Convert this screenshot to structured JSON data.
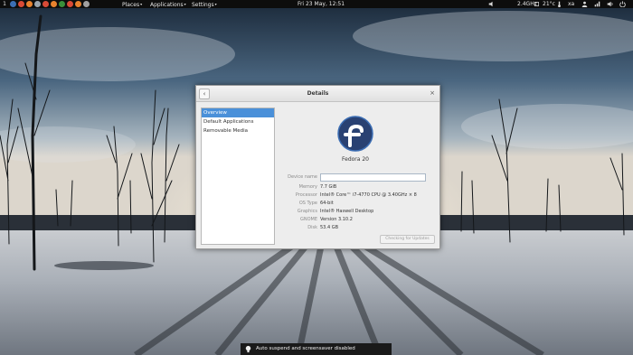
{
  "panel": {
    "workspace": "1",
    "launchers": [
      {
        "icon": "terminal-icon",
        "color": "#3c6fb4"
      },
      {
        "icon": "chrome-icon",
        "color": "#d94a36"
      },
      {
        "icon": "firefox-icon",
        "color": "#e8822e"
      },
      {
        "icon": "files-icon",
        "color": "#9aa4ad"
      },
      {
        "icon": "chrome-icon",
        "color": "#d94a36"
      },
      {
        "icon": "firefox-icon",
        "color": "#e8822e"
      },
      {
        "icon": "chrome-icon",
        "color": "#3a8f3a"
      },
      {
        "icon": "chrome-icon",
        "color": "#d94a36"
      },
      {
        "icon": "firefox-icon",
        "color": "#e8822e"
      },
      {
        "icon": "tools-icon",
        "color": "#a0a0a0"
      }
    ],
    "menus": [
      "Places",
      "Applications",
      "Settings"
    ],
    "clock": "Fri 23 May, 12:51",
    "tray": {
      "cpu": "2.4GHz",
      "temp": "21°c",
      "user": "xa"
    }
  },
  "window": {
    "title": "Details",
    "back_glyph": "‹",
    "close_glyph": "×",
    "sidebar": [
      "Overview",
      "Default Applications",
      "Removable Media"
    ],
    "os_name": "Fedora 20",
    "device_name_label": "Device name",
    "device_name_value": "",
    "info": [
      {
        "label": "Memory",
        "value": "7.7 GiB"
      },
      {
        "label": "Processor",
        "value": "Intel® Core™ i7-4770 CPU @ 3.40GHz × 8"
      },
      {
        "label": "OS Type",
        "value": "64-bit"
      },
      {
        "label": "Graphics",
        "value": "Intel® Haswell Desktop"
      },
      {
        "label": "GNOME",
        "value": "Version 3.10.2"
      },
      {
        "label": "Disk",
        "value": "53.4 GB"
      }
    ],
    "updates_button": "Checking for Updates"
  },
  "notification": {
    "text": "Auto suspend and screensaver disabled"
  },
  "colors": {
    "accent": "#4a90d9",
    "fedora_blue": "#294172",
    "panel": "#0d0d0d"
  }
}
